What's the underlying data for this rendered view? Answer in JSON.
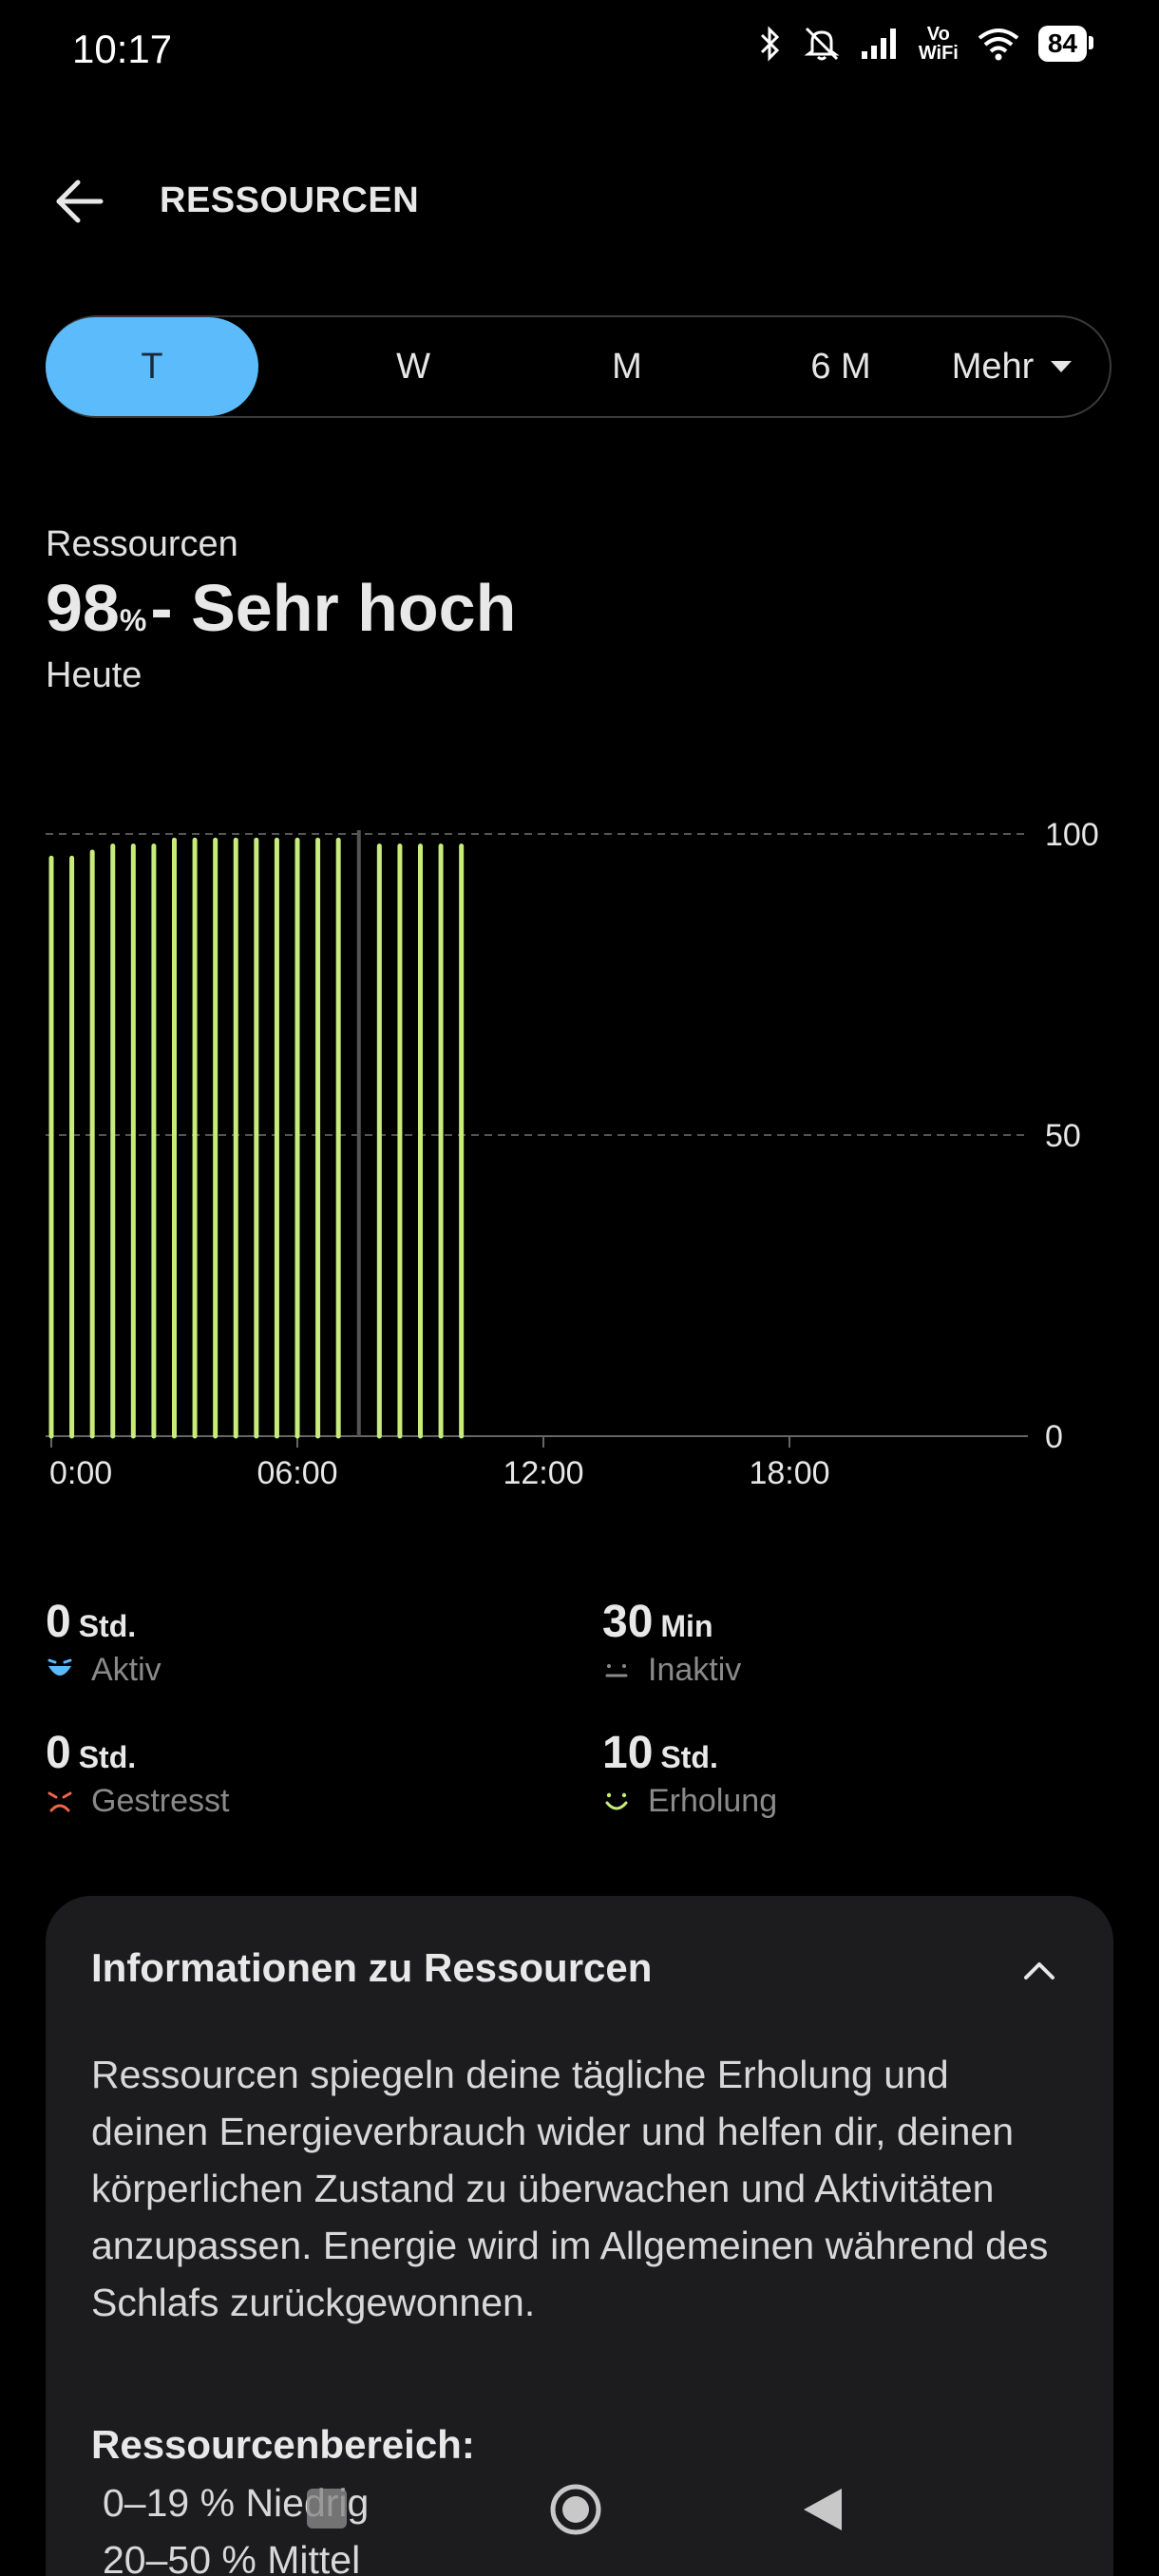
{
  "status_bar": {
    "time": "10:17",
    "vowifi_top": "Vo",
    "vowifi_bottom": "WiFi",
    "battery": "84",
    "icons": [
      "bluetooth-icon",
      "muted-bell-icon",
      "signal-icon",
      "vowifi-icon",
      "wifi-icon",
      "battery-icon"
    ]
  },
  "header": {
    "title": "RESSOURCEN",
    "back_icon": "arrow-left-icon"
  },
  "tabs": [
    {
      "label": "T",
      "active": true
    },
    {
      "label": "W",
      "active": false
    },
    {
      "label": "M",
      "active": false
    },
    {
      "label": "6 M",
      "active": false
    },
    {
      "label": "Mehr",
      "active": false,
      "icon": "caret-down-icon"
    }
  ],
  "summary": {
    "label": "Ressourcen",
    "value": "98",
    "unit": "%",
    "rest": " - Sehr hoch",
    "date": "Heute"
  },
  "chart_data": {
    "type": "bar",
    "x_unit": "hours",
    "xlim": [
      0,
      24
    ],
    "ylim": [
      0,
      100
    ],
    "y_ticks": [
      "100",
      "50",
      "0"
    ],
    "x_ticks": [
      "0:00",
      "06:00",
      "12:00",
      "18:00"
    ],
    "grid": true,
    "bar_color": "#c7ec7a",
    "current_time_marker": 7.5,
    "points": [
      {
        "x": 0.0,
        "y": 96
      },
      {
        "x": 0.5,
        "y": 96
      },
      {
        "x": 1.0,
        "y": 97
      },
      {
        "x": 1.5,
        "y": 98
      },
      {
        "x": 2.0,
        "y": 98
      },
      {
        "x": 2.5,
        "y": 98
      },
      {
        "x": 3.0,
        "y": 99
      },
      {
        "x": 3.5,
        "y": 99
      },
      {
        "x": 4.0,
        "y": 99
      },
      {
        "x": 4.5,
        "y": 99
      },
      {
        "x": 5.0,
        "y": 99
      },
      {
        "x": 5.5,
        "y": 99
      },
      {
        "x": 6.0,
        "y": 99
      },
      {
        "x": 6.5,
        "y": 99
      },
      {
        "x": 7.0,
        "y": 99
      },
      {
        "x": 8.0,
        "y": 98
      },
      {
        "x": 8.5,
        "y": 98
      },
      {
        "x": 9.0,
        "y": 98
      },
      {
        "x": 9.5,
        "y": 98
      },
      {
        "x": 10.0,
        "y": 98
      }
    ]
  },
  "stats": [
    {
      "value": "0",
      "unit": "Std.",
      "label": "Aktiv",
      "icon": "active-face-icon",
      "color": "#5cbcfb"
    },
    {
      "value": "30",
      "unit": "Min",
      "label": "Inaktiv",
      "icon": "inactive-face-icon",
      "color": "#8a8a8a"
    },
    {
      "value": "0",
      "unit": "Std.",
      "label": "Gestresst",
      "icon": "stressed-face-icon",
      "color": "#f0664a"
    },
    {
      "value": "10",
      "unit": "Std.",
      "label": "Erholung",
      "icon": "recovery-face-icon",
      "color": "#c7ec7a"
    }
  ],
  "info_card": {
    "title": "Informationen zu Ressourcen",
    "toggle_icon": "chevron-up-icon",
    "body": "Ressourcen spiegeln deine tägliche Erholung und deinen Energieverbrauch wider und helfen dir, deinen körperlichen Zustand zu überwachen und Aktivitäten anzupassen. Energie wird im Allgemeinen während des Schlafs zurückgewonnen.",
    "range_title": "Ressourcenbereich:",
    "ranges": [
      "0–19 % Niedrig",
      "20–50 % Mittel"
    ]
  },
  "nav_bar": {
    "icons": [
      "recent-apps-icon",
      "home-icon",
      "back-triangle-icon"
    ]
  }
}
